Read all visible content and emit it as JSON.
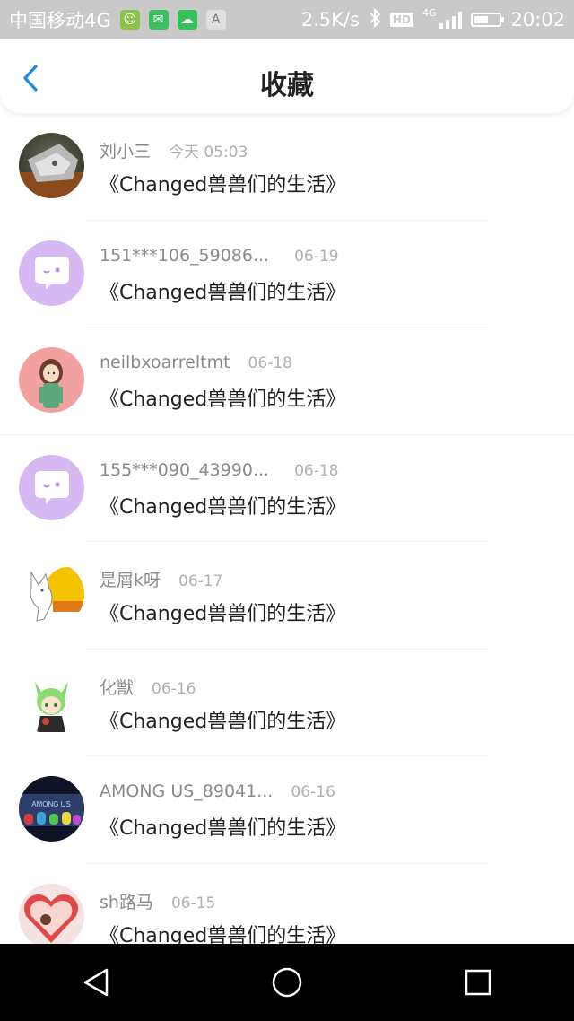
{
  "status_bar": {
    "carrier": "中国移动4G",
    "speed": "2.5K/s",
    "network": "4G",
    "hd": "HD",
    "time": "20:02",
    "battery_level": 0.55,
    "app_icons": [
      {
        "name": "game-app-icon",
        "color": "#8bc34a",
        "glyph": "☺"
      },
      {
        "name": "chat-app-icon",
        "color": "#3cbf60",
        "glyph": "✉"
      },
      {
        "name": "wechat-icon",
        "color": "#34c25a",
        "glyph": "☁"
      },
      {
        "name": "font-app-icon",
        "color": "#9e9e9e",
        "glyph": "A"
      }
    ]
  },
  "header": {
    "title": "收藏",
    "back_icon": "chevron-left-icon",
    "accent_color": "#1e88e5"
  },
  "items": [
    {
      "name": "刘小三",
      "time": "今天 05:03",
      "title": "《Changed兽兽们的生活》",
      "avatar": "dark-photo"
    },
    {
      "name": "151***106_59086...",
      "time": "06-19",
      "title": "《Changed兽兽们的生活》",
      "avatar": "default-purple"
    },
    {
      "name": "neilbxoarreltmt",
      "time": "06-18",
      "title": "《Changed兽兽们的生活》",
      "avatar": "pink-girl"
    },
    {
      "name": "155***090_43990...",
      "time": "06-18",
      "title": "《Changed兽兽们的生活》",
      "avatar": "default-purple"
    },
    {
      "name": "是屑k呀",
      "time": "06-17",
      "title": "《Changed兽兽们的生活》",
      "avatar": "wolf-sketch"
    },
    {
      "name": "化獣",
      "time": "06-16",
      "title": "《Changed兽兽们的生活》",
      "avatar": "green-fox"
    },
    {
      "name": "AMONG US_89041...",
      "time": "06-16",
      "title": "《Changed兽兽们的生活》",
      "avatar": "among-us"
    },
    {
      "name": "sh路马",
      "time": "06-15",
      "title": "《Changed兽兽们的生活》",
      "avatar": "red-heart"
    }
  ],
  "avatar_texts": {
    "among_us": "AMONG US"
  }
}
